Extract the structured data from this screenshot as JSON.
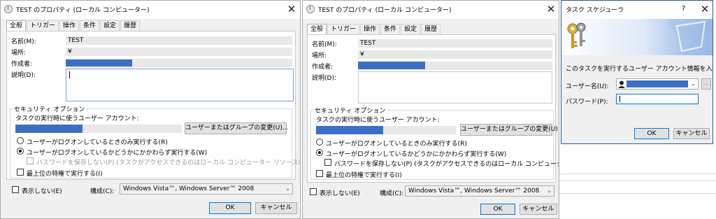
{
  "dialog_left": {
    "title": "TEST のプロパティ (ローカル コンピューター)",
    "tabs": [
      "全般",
      "トリガー",
      "操作",
      "条件",
      "設定",
      "履歴"
    ],
    "fields": {
      "name_label": "名前(M):",
      "name_value": "TEST",
      "location_label": "場所:",
      "location_value": "¥",
      "author_label": "作成者:",
      "description_label": "説明(D):"
    },
    "security": {
      "group_label": "セキュリティ オプション",
      "account_prompt": "タスクの実行時に使うユーザー アカウント:",
      "change_button": "ユーザーまたはグループの変更(U)...",
      "radio_logged_on": "ユーザーがログオンしているときのみ実行する(R)",
      "radio_whether": "ユーザーがログオンしているかどうかにかかわらず実行する(W)",
      "dont_store_password": "パスワードを保存しない(P) (タスクがアクセスできるのはローカル コンピューター リソースのみ)",
      "highest_privileges": "最上位の特権で実行する(I)"
    },
    "hidden_label": "表示しない(E)",
    "configure_label": "構成(C):",
    "configure_value": "Windows Vista™, Windows Server™ 2008",
    "ok_button": "OK",
    "cancel_button": "キャンセル"
  },
  "dialog_middle": {
    "title": "TEST のプロパティ (ローカル コンピューター)",
    "tabs": [
      "全般",
      "トリガー",
      "操作",
      "条件",
      "設定",
      "履歴"
    ],
    "fields": {
      "name_label": "名前(M):",
      "name_value": "TEST",
      "location_label": "場所:",
      "location_value": "¥",
      "author_label": "作成者:",
      "description_label": "説明(D):"
    },
    "security": {
      "group_label": "セキュリティ オプション",
      "account_prompt": "タスクの実行時に使うユーザー アカウント:",
      "change_button": "ユーザーまたはグループの変更(U)...",
      "radio_logged_on": "ユーザーがログオンしているときのみ実行する(R)",
      "radio_whether": "ユーザーがログオンしているかどうかにかかわらず実行する(W)",
      "dont_store_password": "パスワードを保存しない(P) (タスクがアクセスできるのはローカル コンピューター リソースのみ)",
      "highest_privileges": "最上位の特権で実行する(I)"
    },
    "hidden_label": "表示しない(E)",
    "configure_label": "構成(C):",
    "configure_value": "Windows Vista™, Windows Server™ 2008",
    "ok_button": "OK",
    "cancel_button": "キャンセル"
  },
  "dialog_right": {
    "title": "タスク スケジューラ",
    "help_glyph": "?",
    "prompt": "このタスクを実行するユーザー アカウント情報を入力してください。",
    "username_label": "ユーザー名(U):",
    "password_label": "パスワード(P):",
    "browse_glyph": "...",
    "ok_button": "OK",
    "cancel_button": "キャンセル"
  },
  "colors": {
    "redaction": "#3b6fc4",
    "focus_border": "#0078d7"
  }
}
